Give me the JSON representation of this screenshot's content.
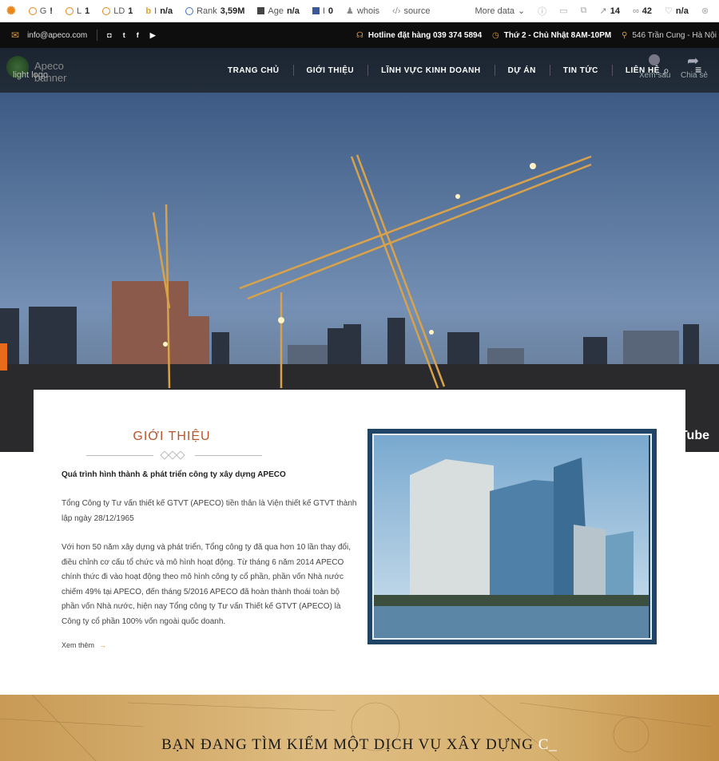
{
  "extension_bar": {
    "items": [
      {
        "icon": "g-icon",
        "label": "G",
        "value": "!"
      },
      {
        "icon": "l-icon",
        "label": "L",
        "value": "1"
      },
      {
        "icon": "ld-icon",
        "label": "LD",
        "value": "1"
      },
      {
        "icon": "b-icon",
        "label": "I",
        "value": "n/a"
      },
      {
        "icon": "rank-icon",
        "label": "Rank",
        "value": "3,59M"
      },
      {
        "icon": "age-icon",
        "label": "Age",
        "value": "n/a"
      },
      {
        "icon": "fb-icon",
        "label": "I",
        "value": "0"
      },
      {
        "icon": "whois-icon",
        "label": "whois",
        "value": ""
      },
      {
        "icon": "source-icon",
        "label": "source",
        "value": ""
      },
      {
        "icon": "",
        "label": "More data",
        "value": ""
      },
      {
        "icon": "external-links-icon",
        "label": "",
        "value": "14"
      },
      {
        "icon": "internal-links-icon",
        "label": "",
        "value": "42"
      },
      {
        "icon": "nofollow-icon",
        "label": "",
        "value": "n/a"
      }
    ]
  },
  "topbar": {
    "email": "info@apeco.com",
    "hotline": "Hotline đặt hàng 039 374 5894",
    "hours": "Thứ 2 - Chủ Nhật 8AM-10PM",
    "address": "546 Trần Cung - Hà Nội"
  },
  "header": {
    "logo_alt": "Apeco banner",
    "logo_alt2": "light logo",
    "nav": [
      "TRANG CHỦ",
      "GIỚI THIỆU",
      "LĨNH VỰC KINH DOANH",
      "DỰ ÁN",
      "TIN TỨC",
      "LIÊN HỆ"
    ],
    "watch_later": "Xem sau",
    "share": "Chia sẻ"
  },
  "intro": {
    "title": "GIỚI THIỆU",
    "subtitle": "Quá trình hình thành & phát triển công ty xây dựng APECO",
    "paragraph1": "Tổng Công ty Tư vấn thiết kế GTVT (APECO) tiền thân là Viện thiết kế GTVT thành lập ngày 28/12/1965",
    "paragraph2": "Với hơn 50 năm xây dựng và phát triển, Tổng công ty đã qua hơn 10 lần thay đổi, điều chỉnh cơ cấu tổ chức và mô hình hoạt động.  Từ tháng 6 năm 2014 APECO chính thức đi vào hoạt động theo mô hình công ty cổ phần, phần vốn Nhà nước chiếm 49% tại APECO, đến tháng 5/2016 APECO đã hoàn thành thoái toàn bộ phần vốn Nhà nước, hiện nay Tổng công ty Tư vấn Thiết kế GTVT (APECO) là Công ty cổ phần 100% vốn ngoài quốc doanh.",
    "read_more": "Xem thêm"
  },
  "youtube_text": "uTube",
  "banner": {
    "heading": "BẠN ĐANG TÌM KIẾM MỘT DỊCH VỤ XÂY DỰNG",
    "cursor": "C_"
  },
  "colors": {
    "accent": "#b8542b",
    "gold": "#d99a3e",
    "dark": "#0e0e0e"
  }
}
